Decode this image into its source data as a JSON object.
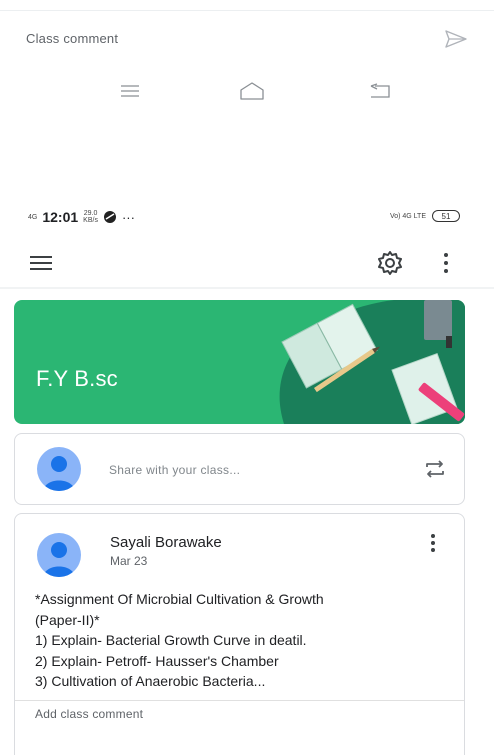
{
  "comment_bar": {
    "label": "Class comment",
    "send_icon": "send-icon",
    "color": "#b0b4ba"
  },
  "nav_bar": {
    "icons": [
      "recent-apps-icon",
      "home-icon",
      "back-icon"
    ]
  },
  "status_bar": {
    "network": "4G",
    "time": "12:01",
    "speed_value": "29.0",
    "speed_unit": "KB/s",
    "more": "···",
    "network_right": "Vo) 4G LTE",
    "battery": "51"
  },
  "app_bar": {
    "menu_icon": "hamburger-menu-icon",
    "settings_icon": "gear-icon",
    "more_icon": "more-vert-icon"
  },
  "banner": {
    "title": "F.Y B.sc",
    "color": "#2bb673",
    "dark_color": "#1a7f5a"
  },
  "share": {
    "placeholder": "Share with your class...",
    "icon": "repost-icon"
  },
  "post": {
    "author": "Sayali Borawake",
    "date": "Mar 23",
    "lines": [
      "*Assignment Of Microbial Cultivation & Growth",
      "(Paper-II)*",
      "1) Explain- Bacterial Growth Curve in deatil.",
      "2) Explain- Petroff-   Hausser's Chamber",
      "3) Cultivation of Anaerobic Bacteria..."
    ],
    "add_comment": "Add class comment"
  },
  "colors": {
    "avatar": "#8ab4f8",
    "avatar_figure": "#1a73e8",
    "text_secondary": "#5f6368"
  }
}
